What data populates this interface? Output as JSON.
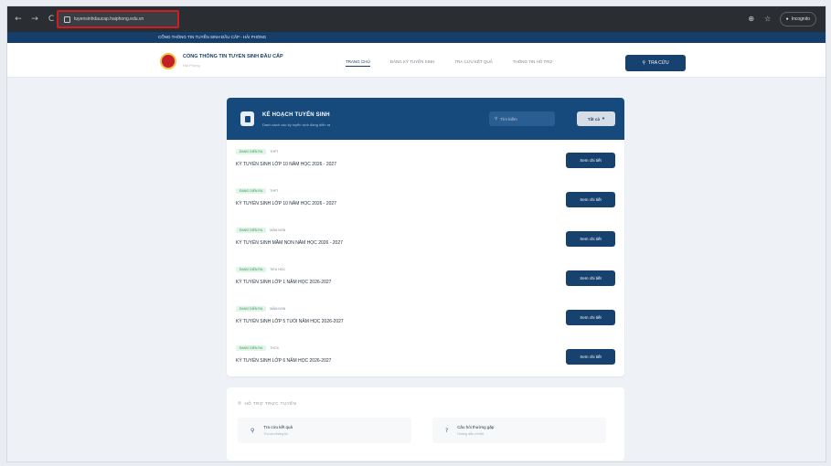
{
  "browser": {
    "url": "tuyensinhdaucap.haiphong.edu.vn",
    "nav_back": "←",
    "nav_forward": "→",
    "nav_reload": "C",
    "icon_zoom": "⊕",
    "icon_star": "☆",
    "incognito_label": "Incognito"
  },
  "topstrip": {
    "text": "CỔNG THÔNG TIN TUYỂN SINH ĐẦU CẤP - HẢI PHÒNG"
  },
  "header": {
    "brand_title": "CỔNG THÔNG TIN TUYỂN SINH ĐẦU CẤP",
    "brand_subtitle": "Hải Phòng",
    "nav": [
      {
        "label": "TRANG CHỦ",
        "active": true
      },
      {
        "label": "ĐĂNG KÝ TUYỂN SINH",
        "active": false
      },
      {
        "label": "TRA CỨU KẾT QUẢ",
        "active": false
      },
      {
        "label": "THÔNG TIN HỖ TRỢ",
        "active": false
      }
    ],
    "login_label": "TRA CỨU"
  },
  "plan_card": {
    "title": "KẾ HOẠCH TUYỂN SINH",
    "subtitle": "Danh sách các kỳ tuyển sinh đang diễn ra",
    "search_placeholder": "Tìm kiếm",
    "filter_label": "Tất cả",
    "rows": [
      {
        "status": "ĐANG DIỄN RA",
        "level": "THPT",
        "title": "KỲ TUYỂN SINH LỚP 10 NĂM HỌC 2026 - 2027",
        "button": "Xem chi tiết"
      },
      {
        "status": "ĐANG DIỄN RA",
        "level": "THPT",
        "title": "KỲ TUYỂN SINH LỚP 10 NĂM HỌC 2026 - 2027",
        "button": "Xem chi tiết"
      },
      {
        "status": "ĐANG DIỄN RA",
        "level": "MẦM NON",
        "title": "KỲ TUYỂN SINH MẦM NON NĂM HỌC 2026 - 2027",
        "button": "Xem chi tiết"
      },
      {
        "status": "ĐANG DIỄN RA",
        "level": "TIỂU HỌC",
        "title": "KỲ TUYỂN SINH LỚP 1 NĂM HỌC 2026-2027",
        "button": "Xem chi tiết"
      },
      {
        "status": "ĐANG DIỄN RA",
        "level": "MẦM NON",
        "title": "KỲ TUYỂN SINH LỚP 5 TUỔI NĂM HỌC 2026-2027",
        "button": "Xem chi tiết"
      },
      {
        "status": "ĐANG DIỄN RA",
        "level": "THCS",
        "title": "KỲ TUYỂN SINH LỚP 6 NĂM HỌC 2026-2027",
        "button": "Xem chi tiết"
      }
    ]
  },
  "support_card": {
    "title": "HỖ TRỢ TRỰC TUYẾN",
    "items": [
      {
        "label": "Tra cứu kết quả",
        "sub": "Tra cứu thông tin"
      },
      {
        "label": "Câu hỏi thường gặp",
        "sub": "Hướng dẫn chi tiết"
      }
    ]
  }
}
